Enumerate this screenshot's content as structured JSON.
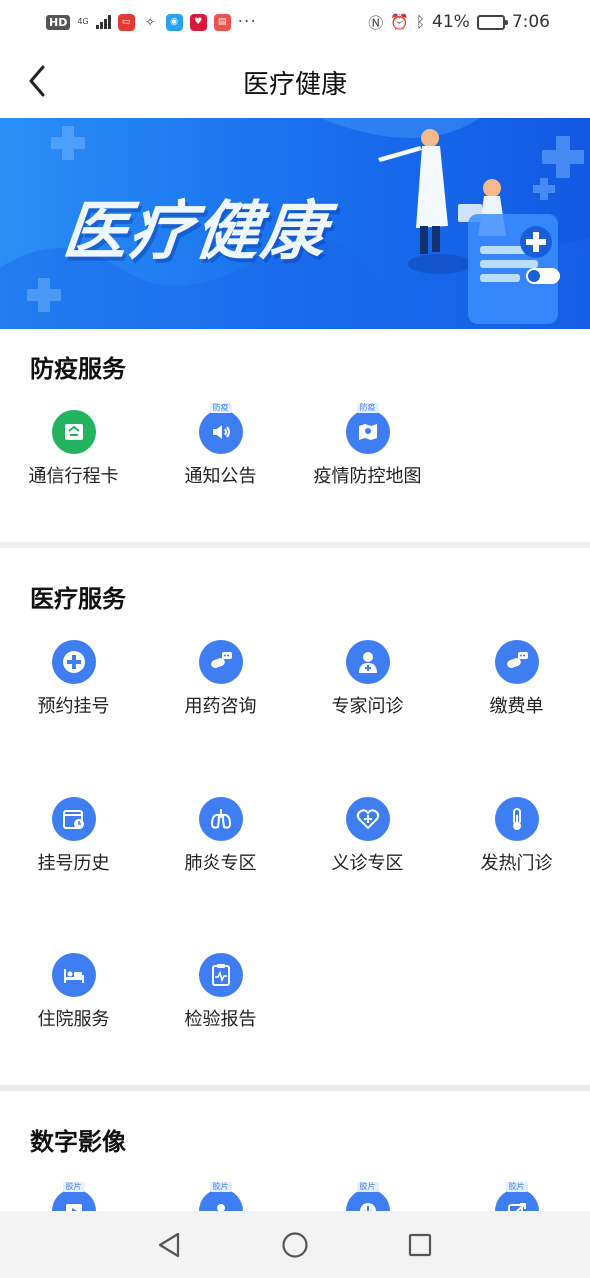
{
  "status_bar": {
    "left": {
      "hd": "HD",
      "network": "4G",
      "dots": "···"
    },
    "right": {
      "battery_percent": "41%",
      "battery_level": 0.41,
      "time": "7:06"
    }
  },
  "nav": {
    "title": "医疗健康",
    "back_icon": "chevron-left-icon"
  },
  "banner": {
    "title": "医疗健康"
  },
  "sections": [
    {
      "title": "防疫服务",
      "items": [
        {
          "label": "通信行程卡",
          "icon": "travel-card-icon",
          "tag": ""
        },
        {
          "label": "通知公告",
          "icon": "speaker-icon",
          "tag": "防疫"
        },
        {
          "label": "疫情防控地图",
          "icon": "map-icon",
          "tag": "防疫"
        }
      ]
    },
    {
      "title": "医疗服务",
      "items": [
        {
          "label": "预约挂号",
          "icon": "medical-cross-icon"
        },
        {
          "label": "用药咨询",
          "icon": "pill-chat-icon"
        },
        {
          "label": "专家问诊",
          "icon": "doctor-icon"
        },
        {
          "label": "缴费单",
          "icon": "pill-chat-icon"
        },
        {
          "label": "挂号历史",
          "icon": "calendar-clock-icon"
        },
        {
          "label": "肺炎专区",
          "icon": "lungs-icon"
        },
        {
          "label": "义诊专区",
          "icon": "heart-plus-icon"
        },
        {
          "label": "发热门诊",
          "icon": "thermometer-icon"
        },
        {
          "label": "住院服务",
          "icon": "hospital-bed-icon"
        },
        {
          "label": "检验报告",
          "icon": "report-icon"
        }
      ]
    },
    {
      "title": "数字影像",
      "items": [
        {
          "label": "",
          "icon": "film-play-icon",
          "tag": "胶片"
        },
        {
          "label": "",
          "icon": "film-person-icon",
          "tag": "胶片"
        },
        {
          "label": "",
          "icon": "film-download-icon",
          "tag": "胶片"
        },
        {
          "label": "",
          "icon": "film-share-icon",
          "tag": "胶片"
        }
      ]
    }
  ],
  "system_nav": {
    "back": "triangle-back-icon",
    "home": "circle-home-icon",
    "recent": "square-recent-icon"
  },
  "colors": {
    "accent": "#3f7ef2",
    "green": "#21b35e",
    "banner": "#1b73ef"
  }
}
